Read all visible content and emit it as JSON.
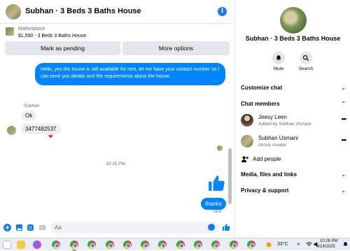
{
  "chat": {
    "title": "Subhan · 3 Beds 3 Baths House",
    "marketplace": {
      "label": "Marketplace",
      "item": "$1,590 - 3 Beds 3 Baths House"
    },
    "buttons": {
      "pending": "Mark as pending",
      "options": "More options"
    },
    "messages": {
      "outgoing_long": "Hello, yes the house is still available for rent, let me have your contact number so I can send you details and the requirements about the house.",
      "sender_name": "Subhan",
      "incoming_1": "Ok",
      "incoming_2": "3477482537",
      "reaction": "❤",
      "timestamp": "10:25 PM",
      "outgoing_thanks": "thanks",
      "status": "Sent"
    },
    "composer": {
      "placeholder": "Aa"
    }
  },
  "sidebar": {
    "name": "Subhan · 3 Beds 3 Baths House",
    "actions": {
      "mute": "Mute",
      "search": "Search"
    },
    "sections": {
      "customize": "Customize chat",
      "members": "Chat members",
      "media": "Media, files and links",
      "privacy": "Privacy & support"
    },
    "members": [
      {
        "name": "Jeesy Leen",
        "sub": "Added by Subhan Usmani"
      },
      {
        "name": "Subhan Usmani",
        "sub": "Group creator"
      }
    ],
    "add_people": "Add people"
  },
  "taskbar": {
    "weather": "33°C",
    "time": "10:26 PM",
    "date": "4/14/2025"
  },
  "colors": {
    "accent": "#0084ff",
    "brand": "#1877f2"
  }
}
